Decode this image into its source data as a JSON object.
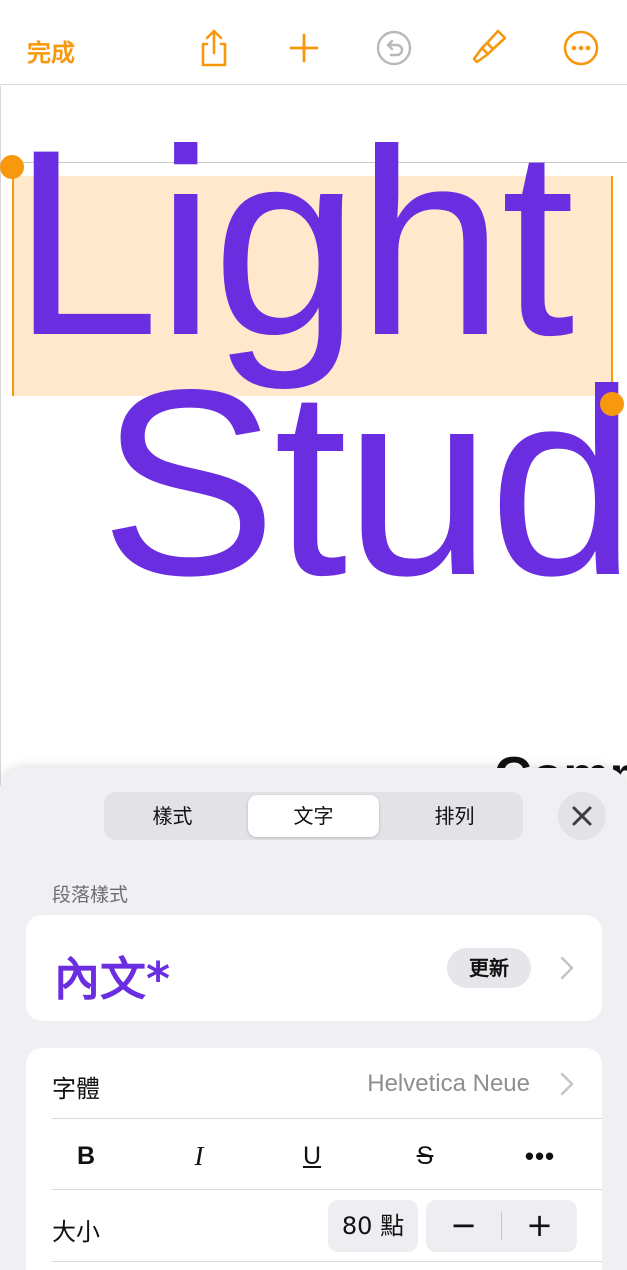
{
  "toolbar": {
    "done_label": "完成",
    "icons": [
      "share-icon",
      "plus-icon",
      "undo-icon",
      "paintbrush-icon",
      "more-icon"
    ],
    "accent_color": "#f7980d"
  },
  "document": {
    "line1": "Light",
    "line2": "Stud",
    "line3": "Comm",
    "text_color": "#6a2ee0"
  },
  "format_panel": {
    "tabs": [
      {
        "label": "樣式",
        "active": false
      },
      {
        "label": "文字",
        "active": true
      },
      {
        "label": "排列",
        "active": false
      }
    ],
    "close_icon": "close-icon",
    "paragraph_style": {
      "section_label": "段落樣式",
      "name": "內文*",
      "update_label": "更新"
    },
    "font": {
      "label": "字體",
      "value": "Helvetica Neue"
    },
    "text_style_buttons": {
      "bold": "B",
      "italic": "I",
      "underline": "U",
      "strikethrough": "S",
      "more": "•••"
    },
    "size": {
      "label": "大小",
      "value": "80 點",
      "decrement": "−",
      "increment": "+"
    }
  }
}
